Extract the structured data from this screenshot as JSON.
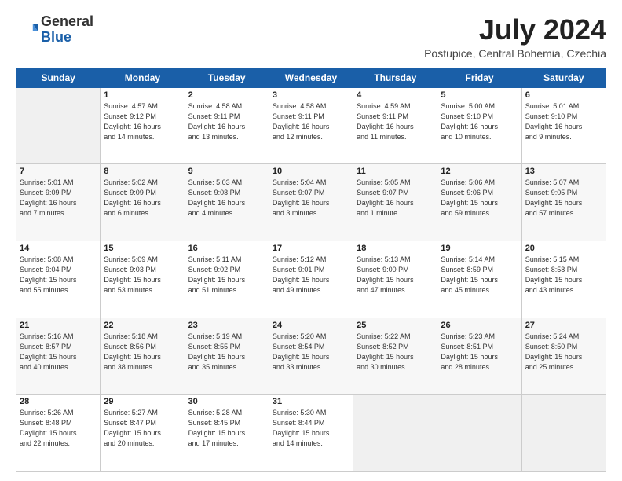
{
  "header": {
    "logo_general": "General",
    "logo_blue": "Blue",
    "month": "July 2024",
    "location": "Postupice, Central Bohemia, Czechia"
  },
  "days_of_week": [
    "Sunday",
    "Monday",
    "Tuesday",
    "Wednesday",
    "Thursday",
    "Friday",
    "Saturday"
  ],
  "weeks": [
    [
      {
        "day": "",
        "info": ""
      },
      {
        "day": "1",
        "info": "Sunrise: 4:57 AM\nSunset: 9:12 PM\nDaylight: 16 hours\nand 14 minutes."
      },
      {
        "day": "2",
        "info": "Sunrise: 4:58 AM\nSunset: 9:11 PM\nDaylight: 16 hours\nand 13 minutes."
      },
      {
        "day": "3",
        "info": "Sunrise: 4:58 AM\nSunset: 9:11 PM\nDaylight: 16 hours\nand 12 minutes."
      },
      {
        "day": "4",
        "info": "Sunrise: 4:59 AM\nSunset: 9:11 PM\nDaylight: 16 hours\nand 11 minutes."
      },
      {
        "day": "5",
        "info": "Sunrise: 5:00 AM\nSunset: 9:10 PM\nDaylight: 16 hours\nand 10 minutes."
      },
      {
        "day": "6",
        "info": "Sunrise: 5:01 AM\nSunset: 9:10 PM\nDaylight: 16 hours\nand 9 minutes."
      }
    ],
    [
      {
        "day": "7",
        "info": "Sunrise: 5:01 AM\nSunset: 9:09 PM\nDaylight: 16 hours\nand 7 minutes."
      },
      {
        "day": "8",
        "info": "Sunrise: 5:02 AM\nSunset: 9:09 PM\nDaylight: 16 hours\nand 6 minutes."
      },
      {
        "day": "9",
        "info": "Sunrise: 5:03 AM\nSunset: 9:08 PM\nDaylight: 16 hours\nand 4 minutes."
      },
      {
        "day": "10",
        "info": "Sunrise: 5:04 AM\nSunset: 9:07 PM\nDaylight: 16 hours\nand 3 minutes."
      },
      {
        "day": "11",
        "info": "Sunrise: 5:05 AM\nSunset: 9:07 PM\nDaylight: 16 hours\nand 1 minute."
      },
      {
        "day": "12",
        "info": "Sunrise: 5:06 AM\nSunset: 9:06 PM\nDaylight: 15 hours\nand 59 minutes."
      },
      {
        "day": "13",
        "info": "Sunrise: 5:07 AM\nSunset: 9:05 PM\nDaylight: 15 hours\nand 57 minutes."
      }
    ],
    [
      {
        "day": "14",
        "info": "Sunrise: 5:08 AM\nSunset: 9:04 PM\nDaylight: 15 hours\nand 55 minutes."
      },
      {
        "day": "15",
        "info": "Sunrise: 5:09 AM\nSunset: 9:03 PM\nDaylight: 15 hours\nand 53 minutes."
      },
      {
        "day": "16",
        "info": "Sunrise: 5:11 AM\nSunset: 9:02 PM\nDaylight: 15 hours\nand 51 minutes."
      },
      {
        "day": "17",
        "info": "Sunrise: 5:12 AM\nSunset: 9:01 PM\nDaylight: 15 hours\nand 49 minutes."
      },
      {
        "day": "18",
        "info": "Sunrise: 5:13 AM\nSunset: 9:00 PM\nDaylight: 15 hours\nand 47 minutes."
      },
      {
        "day": "19",
        "info": "Sunrise: 5:14 AM\nSunset: 8:59 PM\nDaylight: 15 hours\nand 45 minutes."
      },
      {
        "day": "20",
        "info": "Sunrise: 5:15 AM\nSunset: 8:58 PM\nDaylight: 15 hours\nand 43 minutes."
      }
    ],
    [
      {
        "day": "21",
        "info": "Sunrise: 5:16 AM\nSunset: 8:57 PM\nDaylight: 15 hours\nand 40 minutes."
      },
      {
        "day": "22",
        "info": "Sunrise: 5:18 AM\nSunset: 8:56 PM\nDaylight: 15 hours\nand 38 minutes."
      },
      {
        "day": "23",
        "info": "Sunrise: 5:19 AM\nSunset: 8:55 PM\nDaylight: 15 hours\nand 35 minutes."
      },
      {
        "day": "24",
        "info": "Sunrise: 5:20 AM\nSunset: 8:54 PM\nDaylight: 15 hours\nand 33 minutes."
      },
      {
        "day": "25",
        "info": "Sunrise: 5:22 AM\nSunset: 8:52 PM\nDaylight: 15 hours\nand 30 minutes."
      },
      {
        "day": "26",
        "info": "Sunrise: 5:23 AM\nSunset: 8:51 PM\nDaylight: 15 hours\nand 28 minutes."
      },
      {
        "day": "27",
        "info": "Sunrise: 5:24 AM\nSunset: 8:50 PM\nDaylight: 15 hours\nand 25 minutes."
      }
    ],
    [
      {
        "day": "28",
        "info": "Sunrise: 5:26 AM\nSunset: 8:48 PM\nDaylight: 15 hours\nand 22 minutes."
      },
      {
        "day": "29",
        "info": "Sunrise: 5:27 AM\nSunset: 8:47 PM\nDaylight: 15 hours\nand 20 minutes."
      },
      {
        "day": "30",
        "info": "Sunrise: 5:28 AM\nSunset: 8:45 PM\nDaylight: 15 hours\nand 17 minutes."
      },
      {
        "day": "31",
        "info": "Sunrise: 5:30 AM\nSunset: 8:44 PM\nDaylight: 15 hours\nand 14 minutes."
      },
      {
        "day": "",
        "info": ""
      },
      {
        "day": "",
        "info": ""
      },
      {
        "day": "",
        "info": ""
      }
    ]
  ]
}
